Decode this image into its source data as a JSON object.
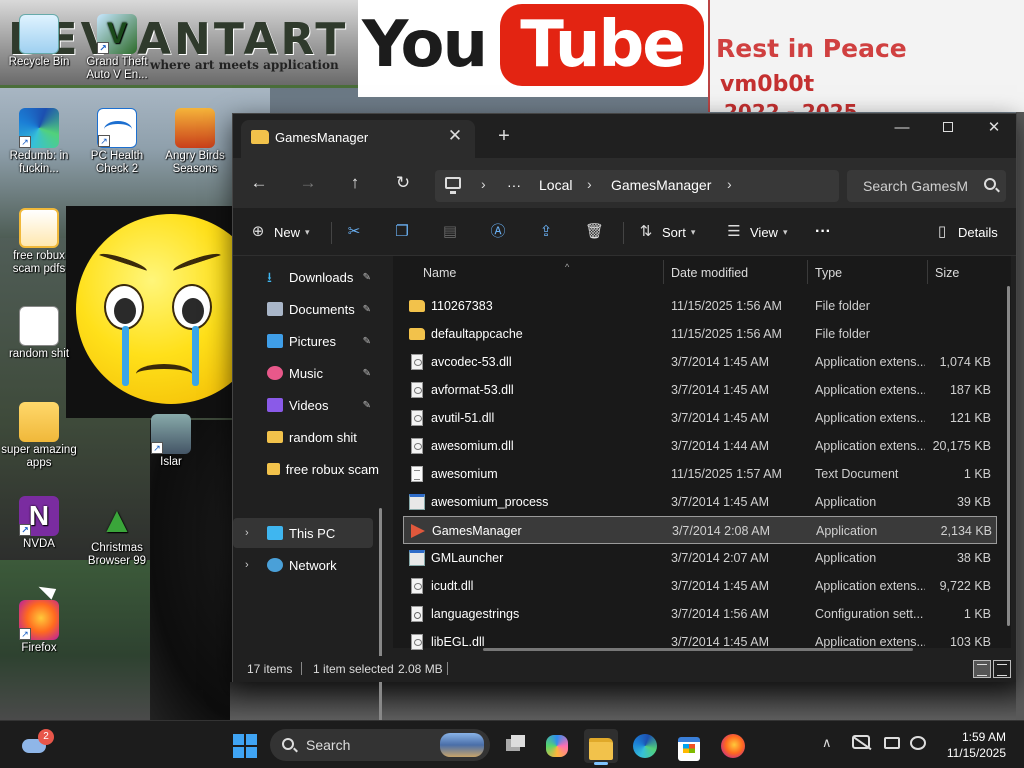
{
  "wallpaper": {
    "deviantart_text": "DEVIANTART",
    "deviantart_tagline": "where art meets application",
    "youtube_you": "You",
    "youtube_tube": "Tube",
    "rip_line1": "Rest in Peace",
    "rip_line2": "vm0b0t",
    "rip_line3": "2022 - 2025"
  },
  "desktop_icons": [
    {
      "label": "Recycle Bin"
    },
    {
      "label": "Grand Theft Auto V En..."
    },
    {
      "label": "Redumb: in fuckin..."
    },
    {
      "label": "PC Health Check 2"
    },
    {
      "label": "Angry Birds Seasons"
    },
    {
      "label": "free robux scam pdfs"
    },
    {
      "label": "random shit"
    },
    {
      "label": "super amazing apps"
    },
    {
      "label": "Islar"
    },
    {
      "label": "NVDA"
    },
    {
      "label": "Christmas Browser 99"
    },
    {
      "label": "Firefox"
    }
  ],
  "window": {
    "tab_title": "GamesManager",
    "tab_close": "✕",
    "tab_new": "+",
    "min": "—",
    "close": "✕"
  },
  "nav": {
    "back": "←",
    "forward": "→",
    "up": "↑",
    "refresh": "↻",
    "ellipsis": "···",
    "breadcrumb": [
      "Local",
      "GamesManager"
    ],
    "separator": "›",
    "search_placeholder": "Search GamesManager"
  },
  "commands": {
    "new": "New",
    "sort": "Sort",
    "view": "View",
    "more": "···",
    "details": "Details"
  },
  "sidebar": {
    "items": [
      {
        "label": "Downloads",
        "pinned": true,
        "color": "#3fb6f0"
      },
      {
        "label": "Documents",
        "pinned": true,
        "color": "#a9b6c8"
      },
      {
        "label": "Pictures",
        "pinned": true,
        "color": "#3f9ee8"
      },
      {
        "label": "Music",
        "pinned": true,
        "color": "#e8588a"
      },
      {
        "label": "Videos",
        "pinned": true,
        "color": "#8a5ae8"
      },
      {
        "label": "random shit",
        "pinned": false,
        "color": "#f2c24b"
      },
      {
        "label": "free robux scam",
        "pinned": false,
        "color": "#f2c24b"
      }
    ],
    "this_pc": "This PC",
    "network": "Network",
    "pin_glyph": "📌"
  },
  "columns": {
    "name": "Name",
    "date": "Date modified",
    "type": "Type",
    "size": "Size"
  },
  "files": [
    {
      "name": "110267383",
      "date": "11/15/2025 1:56 AM",
      "type": "File folder",
      "size": "",
      "icon": "folder"
    },
    {
      "name": "defaultappcache",
      "date": "11/15/2025 1:56 AM",
      "type": "File folder",
      "size": "",
      "icon": "folder"
    },
    {
      "name": "avcodec-53.dll",
      "date": "3/7/2014 1:45 AM",
      "type": "Application extens...",
      "size": "1,074 KB",
      "icon": "dll"
    },
    {
      "name": "avformat-53.dll",
      "date": "3/7/2014 1:45 AM",
      "type": "Application extens...",
      "size": "187 KB",
      "icon": "dll"
    },
    {
      "name": "avutil-51.dll",
      "date": "3/7/2014 1:45 AM",
      "type": "Application extens...",
      "size": "121 KB",
      "icon": "dll"
    },
    {
      "name": "awesomium.dll",
      "date": "3/7/2014 1:44 AM",
      "type": "Application extens...",
      "size": "20,175 KB",
      "icon": "dll"
    },
    {
      "name": "awesomium",
      "date": "11/15/2025 1:57 AM",
      "type": "Text Document",
      "size": "1 KB",
      "icon": "txt"
    },
    {
      "name": "awesomium_process",
      "date": "3/7/2014 1:45 AM",
      "type": "Application",
      "size": "39 KB",
      "icon": "app"
    },
    {
      "name": "GamesManager",
      "date": "3/7/2014 2:08 AM",
      "type": "Application",
      "size": "2,134 KB",
      "icon": "gm",
      "selected": true
    },
    {
      "name": "GMLauncher",
      "date": "3/7/2014 2:07 AM",
      "type": "Application",
      "size": "38 KB",
      "icon": "app"
    },
    {
      "name": "icudt.dll",
      "date": "3/7/2014 1:45 AM",
      "type": "Application extens...",
      "size": "9,722 KB",
      "icon": "dll"
    },
    {
      "name": "languagestrings",
      "date": "3/7/2014 1:56 AM",
      "type": "Configuration sett...",
      "size": "1 KB",
      "icon": "cfg"
    },
    {
      "name": "libEGL.dll",
      "date": "3/7/2014 1:45 AM",
      "type": "Application extens...",
      "size": "103 KB",
      "icon": "dll"
    }
  ],
  "status": {
    "items": "17 items",
    "selected": "1 item selected",
    "size": "2.08 MB"
  },
  "taskbar": {
    "weather_badge": "2",
    "search_label": "Search",
    "time": "1:59 AM",
    "date": "11/15/2025",
    "tray_chevron": "∧"
  }
}
